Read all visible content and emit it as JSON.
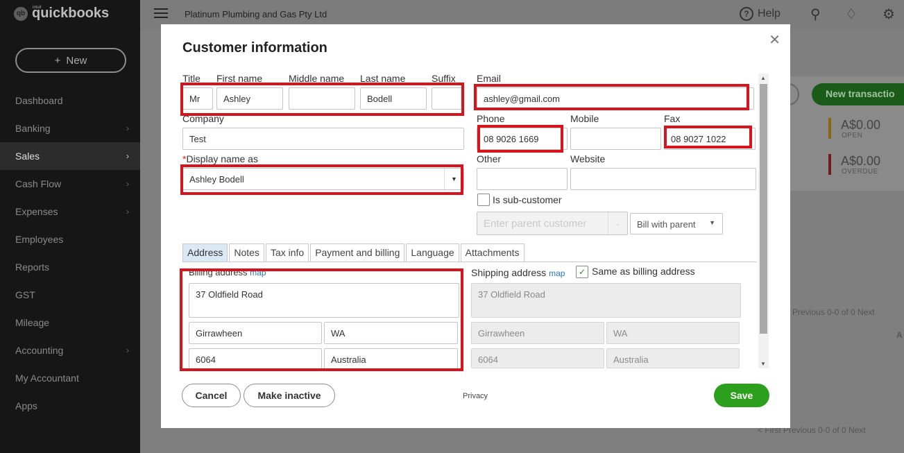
{
  "sidebar": {
    "logo_small": "intuit",
    "logo": "quickbooks",
    "logo_badge": "qb",
    "new_button": "New",
    "items": [
      {
        "label": "Dashboard",
        "chevron": false
      },
      {
        "label": "Banking",
        "chevron": true
      },
      {
        "label": "Sales",
        "chevron": true,
        "active": true
      },
      {
        "label": "Cash Flow",
        "chevron": true
      },
      {
        "label": "Expenses",
        "chevron": true
      },
      {
        "label": "Employees",
        "chevron": false
      },
      {
        "label": "Reports",
        "chevron": false
      },
      {
        "label": "GST",
        "chevron": false
      },
      {
        "label": "Mileage",
        "chevron": false
      },
      {
        "label": "Accounting",
        "chevron": true
      },
      {
        "label": "My Accountant",
        "chevron": false
      },
      {
        "label": "Apps",
        "chevron": false
      }
    ]
  },
  "header": {
    "company": "Platinum Plumbing and Gas Pty Ltd",
    "help": "Help"
  },
  "background": {
    "new_transaction": "New transactio",
    "open_amount": "A$0.00",
    "open_label": "OPEN",
    "overdue_amount": "A$0.00",
    "overdue_label": "OVERDUE",
    "pager_top": "Previous  0-0 of 0   Next",
    "pager_bottom": "< First  Previous  0-0 of 0   Next",
    "col_letter": "A"
  },
  "modal": {
    "title": "Customer information",
    "labels": {
      "title": "Title",
      "first_name": "First name",
      "middle_name": "Middle name",
      "last_name": "Last name",
      "suffix": "Suffix",
      "email": "Email",
      "company": "Company",
      "phone": "Phone",
      "mobile": "Mobile",
      "fax": "Fax",
      "display_name": "Display name as",
      "other": "Other",
      "website": "Website",
      "sub_customer": "Is sub-customer"
    },
    "values": {
      "title": "Mr",
      "first_name": "Ashley",
      "middle_name": "",
      "last_name": "Bodell",
      "suffix": "",
      "email": "ashley@gmail.com",
      "company": "Test",
      "phone": "08 9026 1669",
      "mobile": "",
      "fax": "08 9027 1022",
      "display_name": "Ashley Bodell",
      "other": "",
      "website": ""
    },
    "parent_placeholder": "Enter parent customer",
    "bill_with_parent": "Bill with parent",
    "tabs": [
      "Address",
      "Notes",
      "Tax info",
      "Payment and billing",
      "Language",
      "Attachments"
    ],
    "billing": {
      "label": "Billing address",
      "map": "map",
      "street": "37 Oldfield Road",
      "city": "Girrawheen",
      "state": "WA",
      "postcode": "6064",
      "country": "Australia"
    },
    "shipping": {
      "label": "Shipping address",
      "map": "map",
      "same_as_billing": "Same as billing address",
      "street": "37 Oldfield Road",
      "city": "Girrawheen",
      "state": "WA",
      "postcode": "6064",
      "country": "Australia"
    },
    "buttons": {
      "cancel": "Cancel",
      "make_inactive": "Make inactive",
      "privacy": "Privacy",
      "save": "Save"
    }
  },
  "colors": {
    "highlight": "#d7131d",
    "save": "#2ca01c",
    "link": "#2379b8"
  }
}
